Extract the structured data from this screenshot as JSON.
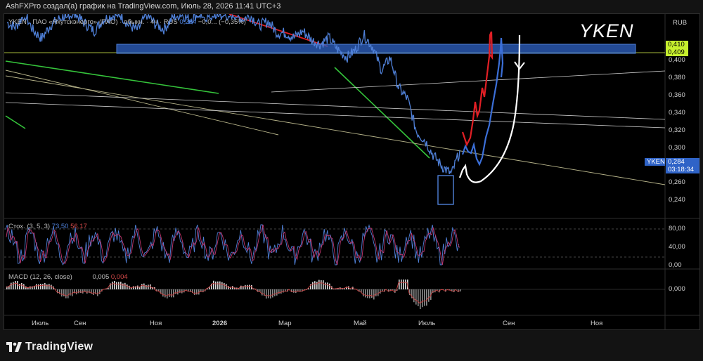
{
  "header": {
    "caption": "AshFXPro создал(а) график на TradingView.com, Июль 28, 2026 11:41 UTC+3"
  },
  "symbol_legend": {
    "ticker": "YKEN",
    "description": "· ПАО «Якутскэнерго» (ПАО) · обыкн. · 4ч · RUS",
    "last": "0,284",
    "change": "−0,0... (−0,35%)"
  },
  "annotation": {
    "title": "YKEN"
  },
  "price_axis": {
    "currency": "RUB",
    "ticks": [
      "0,400",
      "0,380",
      "0,360",
      "0,340",
      "0,320",
      "0,300",
      "0,260",
      "0,240"
    ],
    "zone_top_label": "0,410",
    "zone_bottom_label": "0,409",
    "last_price": "0,284",
    "countdown": "03:18:34",
    "ticker_tag": "YKEN"
  },
  "time_axis": {
    "labels": [
      "Июль",
      "Сен",
      "Ноя",
      "2026",
      "Мар",
      "Май",
      "Июль",
      "Сен",
      "Ноя"
    ]
  },
  "stoch": {
    "label": "Стох. (3, 5, 3)",
    "k_value": "73,50",
    "d_value": "56,17",
    "ticks": [
      "80,00",
      "40,00",
      "0,00"
    ]
  },
  "macd": {
    "label": "MACD (12, 26, close)",
    "macd_value": "0,005",
    "signal_value": "0,004",
    "ticks": [
      "0,000"
    ]
  },
  "footer": {
    "brand": "TradingView"
  },
  "colors": {
    "price_line": "#4f80d8",
    "forecast_red": "#e11f25",
    "forecast_blue": "#3b6fd8",
    "forecast_white": "#ffffff",
    "zone": "#2f63c7",
    "zone_label": "#c6ef2e",
    "green_line": "#35c43b",
    "stoch_k": "#4f80d8",
    "stoch_d": "#c0356d"
  },
  "chart_data": [
    {
      "type": "line",
      "title": "",
      "xlabel": "",
      "ylabel": "RUB",
      "x_ticks": [
        "Июль",
        "Сен",
        "Ноя",
        "2026",
        "Мар",
        "Май",
        "Июль",
        "Сен",
        "Ноя"
      ],
      "ylim": [
        0.225,
        0.43
      ],
      "series": [
        {
          "name": "YKEN",
          "x_idx": [
            0,
            0.12,
            0.25,
            0.38,
            0.5,
            0.62,
            0.75,
            0.88,
            1.0,
            1.12,
            1.25,
            1.38,
            1.5,
            1.62,
            1.75,
            1.88,
            2.0,
            2.12,
            2.25,
            2.38,
            2.5,
            2.62,
            2.75,
            2.88,
            3.0,
            3.12,
            3.25,
            3.38,
            3.5,
            3.62,
            3.75,
            3.88,
            4.0,
            4.12,
            4.25,
            4.38,
            4.5,
            4.62,
            4.75,
            4.88,
            5.0,
            5.12,
            5.25,
            5.38,
            5.5,
            5.62,
            5.75,
            5.88,
            6.0,
            6.12,
            6.25,
            6.38,
            6.5
          ],
          "values": [
            0.421,
            0.416,
            0.43,
            0.412,
            0.404,
            0.418,
            0.425,
            0.43,
            0.428,
            0.42,
            0.412,
            0.424,
            0.428,
            0.43,
            0.418,
            0.413,
            0.43,
            0.42,
            0.414,
            0.426,
            0.43,
            0.424,
            0.43,
            0.426,
            0.43,
            0.428,
            0.43,
            0.425,
            0.428,
            0.418,
            0.422,
            0.41,
            0.41,
            0.405,
            0.412,
            0.402,
            0.398,
            0.405,
            0.392,
            0.384,
            0.392,
            0.408,
            0.395,
            0.37,
            0.384,
            0.352,
            0.34,
            0.305,
            0.296,
            0.28,
            0.268,
            0.26,
            0.284
          ]
        }
      ],
      "zones": [
        {
          "name": "resistance",
          "from": 0.409,
          "to": 0.41
        }
      ]
    },
    {
      "type": "line",
      "title": "Стох. (3, 5, 3)",
      "ylim": [
        0,
        100
      ],
      "series": [
        {
          "name": "%K",
          "last": 73.5
        },
        {
          "name": "%D",
          "last": 56.17
        }
      ],
      "levels": [
        80,
        20
      ]
    },
    {
      "type": "bar",
      "title": "MACD (12, 26, close)",
      "series": [
        {
          "name": "MACD",
          "last": 0.005
        },
        {
          "name": "Signal",
          "last": 0.004
        }
      ]
    }
  ]
}
